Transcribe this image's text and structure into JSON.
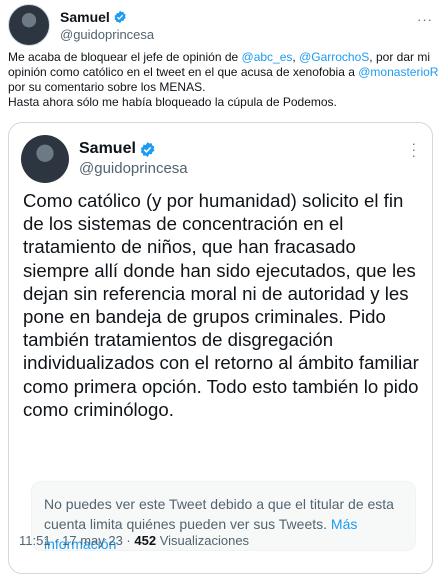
{
  "outer_tweet": {
    "name": "Samuel",
    "handle": "@guidoprincesa",
    "text_part1": "Me acaba de bloquear el jefe de opinión de ",
    "mention1": "@abc_es",
    "text_part2": ", ",
    "mention2": "@GarrochoS",
    "text_part3": ", por dar mi opinión como católico en el tweet en el que acusa de xenofobia a ",
    "mention3": "@monasterioR",
    "text_part4": " por su comentario sobre los MENAS.",
    "text_line_last": "Hasta ahora sólo me había bloqueado la cúpula de Podemos.",
    "more_icon": "···"
  },
  "quoted_tweet": {
    "name": "Samuel",
    "handle": "@guidoprincesa",
    "text": "Como católico (y por humanidad) solicito el fin de los sistemas de concentración en el tratamiento de niños, que han fracasado siempre allí donde han sido ejecutados, que les dejan sin referencia moral ni de autoridad y les pone en bandeja de grupos criminales. Pido también tratamientos de disgregación individualizados con el retorno al ámbito familiar como primera opción. Todo esto también lo pido como criminólogo.",
    "time": "11:51 · 17 may 23 · ",
    "views_count": "452",
    "views_label": " Visualizaciones",
    "notice_text": "No puedes ver este Tweet debido a que el titular de esta cuenta limita quiénes pueden ver sus Tweets. ",
    "notice_link": "Más información"
  },
  "colors": {
    "accent": "#1d9bf0",
    "muted": "#536471",
    "text": "#0f1419",
    "border": "#cfd9de"
  },
  "icons": [
    "verified-badge-icon",
    "more-options-icon"
  ]
}
